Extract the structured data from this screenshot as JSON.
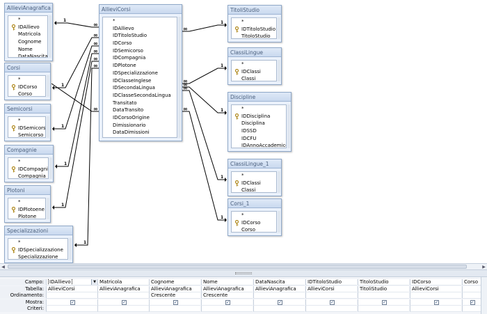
{
  "colors": {
    "table_bg": "#eaf1fb",
    "title_text": "#4a5f7d",
    "line": "#000000"
  },
  "tables": [
    {
      "id": "AllieviAnagrafica",
      "title": "AllieviAnagrafica",
      "fields": [
        {
          "name": "*",
          "key": false
        },
        {
          "name": "IDAllievo",
          "key": true
        },
        {
          "name": "Matricola",
          "key": false
        },
        {
          "name": "Cognome",
          "key": false
        },
        {
          "name": "Nome",
          "key": false
        },
        {
          "name": "DataNascita",
          "key": false
        }
      ]
    },
    {
      "id": "Corsi",
      "title": "Corsi",
      "fields": [
        {
          "name": "*",
          "key": false
        },
        {
          "name": "IDCorso",
          "key": true
        },
        {
          "name": "Corso",
          "key": false
        }
      ]
    },
    {
      "id": "Semicorsi",
      "title": "Semicorsi",
      "fields": [
        {
          "name": "*",
          "key": false
        },
        {
          "name": "IDSemicorso",
          "key": true
        },
        {
          "name": "Semicorso",
          "key": false
        }
      ]
    },
    {
      "id": "Compagnie",
      "title": "Compagnie",
      "fields": [
        {
          "name": "*",
          "key": false
        },
        {
          "name": "IDCompagnia",
          "key": true
        },
        {
          "name": "Compagnia",
          "key": false
        }
      ]
    },
    {
      "id": "Plotoni",
      "title": "Plotoni",
      "fields": [
        {
          "name": "*",
          "key": false
        },
        {
          "name": "IDPlotoene",
          "key": true
        },
        {
          "name": "Plotone",
          "key": false
        }
      ]
    },
    {
      "id": "Specializzazioni",
      "title": "Specializzazioni",
      "fields": [
        {
          "name": "*",
          "key": false
        },
        {
          "name": "IDSpecializzazione",
          "key": true
        },
        {
          "name": "Specializzazione",
          "key": false
        }
      ]
    },
    {
      "id": "AllieviCorsi",
      "title": "AllieviCorsi",
      "fields": [
        {
          "name": "*",
          "key": false
        },
        {
          "name": "IDAllievo",
          "key": false
        },
        {
          "name": "IDTitoloStudio",
          "key": false
        },
        {
          "name": "IDCorso",
          "key": false
        },
        {
          "name": "IDSemicorso",
          "key": false
        },
        {
          "name": "IDCompagnia",
          "key": false
        },
        {
          "name": "IDPlotone",
          "key": false
        },
        {
          "name": "IDSpecializzazione",
          "key": false
        },
        {
          "name": "IDClasseInglese",
          "key": false
        },
        {
          "name": "IDSecondaLingua",
          "key": false
        },
        {
          "name": "IDClasseSecondaLingua",
          "key": false
        },
        {
          "name": "Transitato",
          "key": false
        },
        {
          "name": "DataTransito",
          "key": false
        },
        {
          "name": "IDCorsoOrigine",
          "key": false
        },
        {
          "name": "Dimissionario",
          "key": false
        },
        {
          "name": "DataDimissioni",
          "key": false
        },
        {
          "name": "Note",
          "key": false
        }
      ]
    },
    {
      "id": "TitoliStudio",
      "title": "TitoliStudio",
      "fields": [
        {
          "name": "*",
          "key": false
        },
        {
          "name": "IDTitoloStudio",
          "key": true
        },
        {
          "name": "TitoloStudio",
          "key": false
        }
      ]
    },
    {
      "id": "ClassiLingue",
      "title": "ClassiLingue",
      "fields": [
        {
          "name": "*",
          "key": false
        },
        {
          "name": "IDClassi",
          "key": true
        },
        {
          "name": "Classi",
          "key": false
        }
      ]
    },
    {
      "id": "Discipline",
      "title": "Discipline",
      "fields": [
        {
          "name": "*",
          "key": false
        },
        {
          "name": "IDDisciplina",
          "key": true
        },
        {
          "name": "Disciplina",
          "key": false
        },
        {
          "name": "IDSSD",
          "key": false
        },
        {
          "name": "IDCFU",
          "key": false
        },
        {
          "name": "IDAnnoAccademico",
          "key": false
        }
      ]
    },
    {
      "id": "ClassiLingue_1",
      "title": "ClassiLingue_1",
      "fields": [
        {
          "name": "*",
          "key": false
        },
        {
          "name": "IDClassi",
          "key": true
        },
        {
          "name": "Classi",
          "key": false
        }
      ]
    },
    {
      "id": "Corsi_1",
      "title": "Corsi_1",
      "fields": [
        {
          "name": "*",
          "key": false
        },
        {
          "name": "IDCorso",
          "key": true
        },
        {
          "name": "Corso",
          "key": false
        }
      ]
    }
  ],
  "relations": {
    "one_label": "1",
    "many_label": "∞"
  },
  "grid": {
    "row_labels": [
      "Campo:",
      "Tabella:",
      "Ordinamento:",
      "Mostra:",
      "Criteri:"
    ],
    "columns": [
      {
        "campo": "IDAllievo",
        "tabella": "AllieviCorsi",
        "ordinamento": "",
        "mostra": true
      },
      {
        "campo": "Matricola",
        "tabella": "AllieviAnagrafica",
        "ordinamento": "",
        "mostra": true
      },
      {
        "campo": "Cognome",
        "tabella": "AllieviAnagrafica",
        "ordinamento": "Crescente",
        "mostra": true
      },
      {
        "campo": "Nome",
        "tabella": "AllieviAnagrafica",
        "ordinamento": "Crescente",
        "mostra": true
      },
      {
        "campo": "DataNascita",
        "tabella": "AllieviAnagrafica",
        "ordinamento": "",
        "mostra": true
      },
      {
        "campo": "IDTitoloStudio",
        "tabella": "AllieviCorsi",
        "ordinamento": "",
        "mostra": true
      },
      {
        "campo": "TitoloStudio",
        "tabella": "TitoliStudio",
        "ordinamento": "",
        "mostra": true
      },
      {
        "campo": "IDCorso",
        "tabella": "AllieviCorsi",
        "ordinamento": "",
        "mostra": true
      },
      {
        "campo": "Corso",
        "tabella": "",
        "ordinamento": "",
        "mostra": true
      }
    ]
  }
}
